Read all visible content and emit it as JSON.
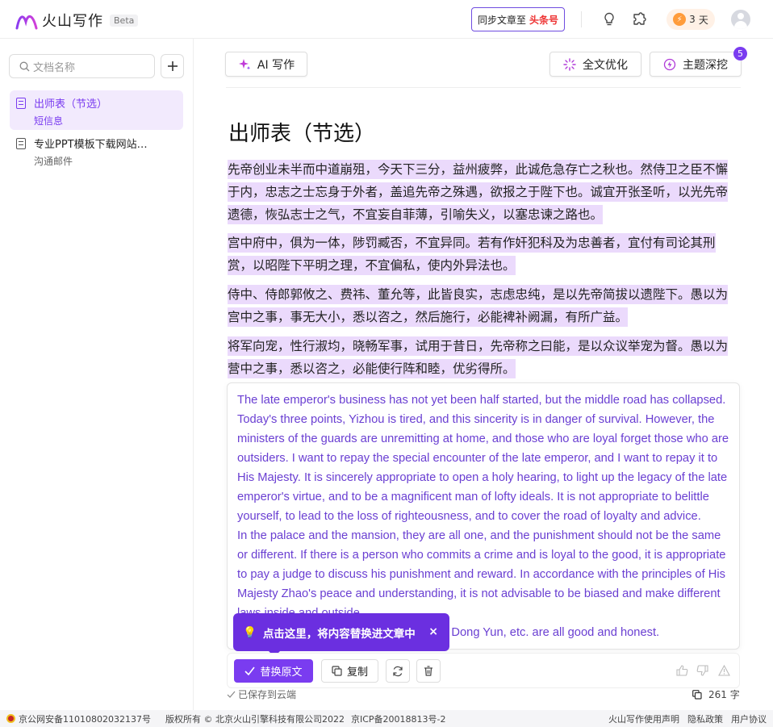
{
  "header": {
    "app_name": "火山写作",
    "beta": "Beta",
    "sync_label": "同步文章至",
    "sync_target": "头条号",
    "streak_count": "3",
    "streak_unit": "天"
  },
  "sidebar": {
    "search_placeholder": "文档名称",
    "docs": [
      {
        "title": "出师表（节选）",
        "subtitle": "短信息"
      },
      {
        "title": "专业PPT模板下载网站…",
        "subtitle": "沟通邮件"
      }
    ]
  },
  "toolbar": {
    "ai_write": "AI 写作",
    "optimize": "全文优化",
    "deep_dig": "主题深挖",
    "deep_dig_badge": "5"
  },
  "document": {
    "title": "出师表（节选）",
    "paragraphs": [
      "先帝创业未半而中道崩殂，今天下三分，益州疲弊，此诚危急存亡之秋也。然侍卫之臣不懈于内，忠志之士忘身于外者，盖追先帝之殊遇，欲报之于陛下也。诚宜开张圣听，以光先帝遗德，恢弘志士之气，不宜妄自菲薄，引喻失义，以塞忠谏之路也。",
      "宫中府中，俱为一体，陟罚臧否，不宜异同。若有作奸犯科及为忠善者，宜付有司论其刑赏，以昭陛下平明之理，不宜偏私，使内外异法也。",
      "侍中、侍郎郭攸之、费祎、董允等，此皆良实，志虑忠纯，是以先帝简拔以遗陛下。愚以为宫中之事，事无大小，悉以咨之，然后施行，必能裨补阙漏，有所广益。",
      "将军向宠，性行淑均，晓畅军事，试用于昔日，先帝称之曰能，是以众议举宠为督。愚以为营中之事，悉以咨之，必能使行阵和睦，优劣得所。"
    ]
  },
  "translation": {
    "text_1": "The late emperor's business has not yet been half started, but the middle road has collapsed. Today's three points, Yizhou is tired, and this sincerity is in danger of survival. However, the ministers of the guards are unremitting at home, and those who are loyal forget those who are outsiders. I want to repay the special encounter of the late emperor, and I want to repay it to His Majesty. It is sincerely appropriate to open a holy hearing, to light up the legacy of the late emperor's virtue, and to be a magnificent man of lofty ideals. It is not appropriate to belittle yourself, to lead to the loss of righteousness, and to cover the road of loyalty and advice.",
    "text_2": "In the palace and the mansion, they are all one, and the punishment should not be the same or different. If there is a person who commits a crime and is loyal to the good, it is appropriate to pay a judge to discuss his punishment and reward. In accordance with the principles of His Majesty Zhao's peace and understanding, it is not advisable to be biased and make different laws inside and outside.",
    "text_3": "Shi Zhong, Shi Lang Guo Youzhi, Fei Yi, Dong Yun, etc. are all good and honest."
  },
  "tooltip": {
    "text": "点击这里，将内容替换进文章中",
    "close": "×"
  },
  "actions": {
    "replace": "替换原文",
    "copy": "复制"
  },
  "status": {
    "saved": "已保存到云端",
    "word_count": "261",
    "word_unit": "字"
  },
  "footer": {
    "icp_police": "京公网安备11010802032137号",
    "copyright": "版权所有 © 北京火山引擎科技有限公司2022",
    "icp": "京ICP备20018813号-2",
    "terms": "火山写作使用声明",
    "privacy": "隐私政策",
    "agreement": "用户协议"
  },
  "colors": {
    "accent": "#7a3cf0",
    "highlight": "#ebdafc",
    "translation_text": "#6a3fd2"
  }
}
